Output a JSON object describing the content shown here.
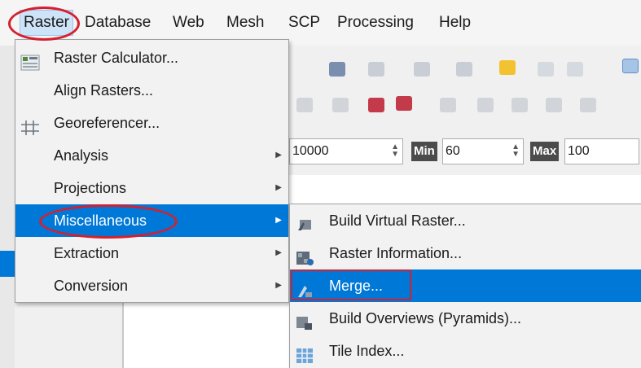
{
  "menubar": {
    "items": [
      {
        "label": "Raster",
        "state": "open"
      },
      {
        "label": "Database"
      },
      {
        "label": "Web"
      },
      {
        "label": "Mesh"
      },
      {
        "label": "SCP"
      },
      {
        "label": "Processing"
      },
      {
        "label": "Help"
      }
    ]
  },
  "raster_menu": {
    "items": [
      {
        "label": "Raster Calculator...",
        "icon": "raster-calculator-icon"
      },
      {
        "label": "Align Rasters..."
      },
      {
        "label": "Georeferencer...",
        "icon": "georeferencer-icon"
      },
      {
        "label": "Analysis",
        "submenu": true
      },
      {
        "label": "Projections",
        "submenu": true
      },
      {
        "label": "Miscellaneous",
        "submenu": true,
        "highlighted": true
      },
      {
        "label": "Extraction",
        "submenu": true
      },
      {
        "label": "Conversion",
        "submenu": true
      }
    ]
  },
  "misc_submenu": {
    "items": [
      {
        "label": "Build Virtual Raster...",
        "icon": "build-virtual-raster-icon"
      },
      {
        "label": "Raster Information...",
        "icon": "raster-information-icon"
      },
      {
        "label": "Merge...",
        "icon": "merge-icon",
        "highlighted": true
      },
      {
        "label": "Build Overviews (Pyramids)...",
        "icon": "build-overviews-icon"
      },
      {
        "label": "Tile Index...",
        "icon": "tile-index-icon"
      }
    ]
  },
  "toolbar_fields": {
    "first_value": "10000",
    "min_label": "Min",
    "min_value": "60",
    "max_label": "Max",
    "max_value": "100"
  },
  "annotation_color": "#d4202e",
  "highlight_color": "#0078d7"
}
